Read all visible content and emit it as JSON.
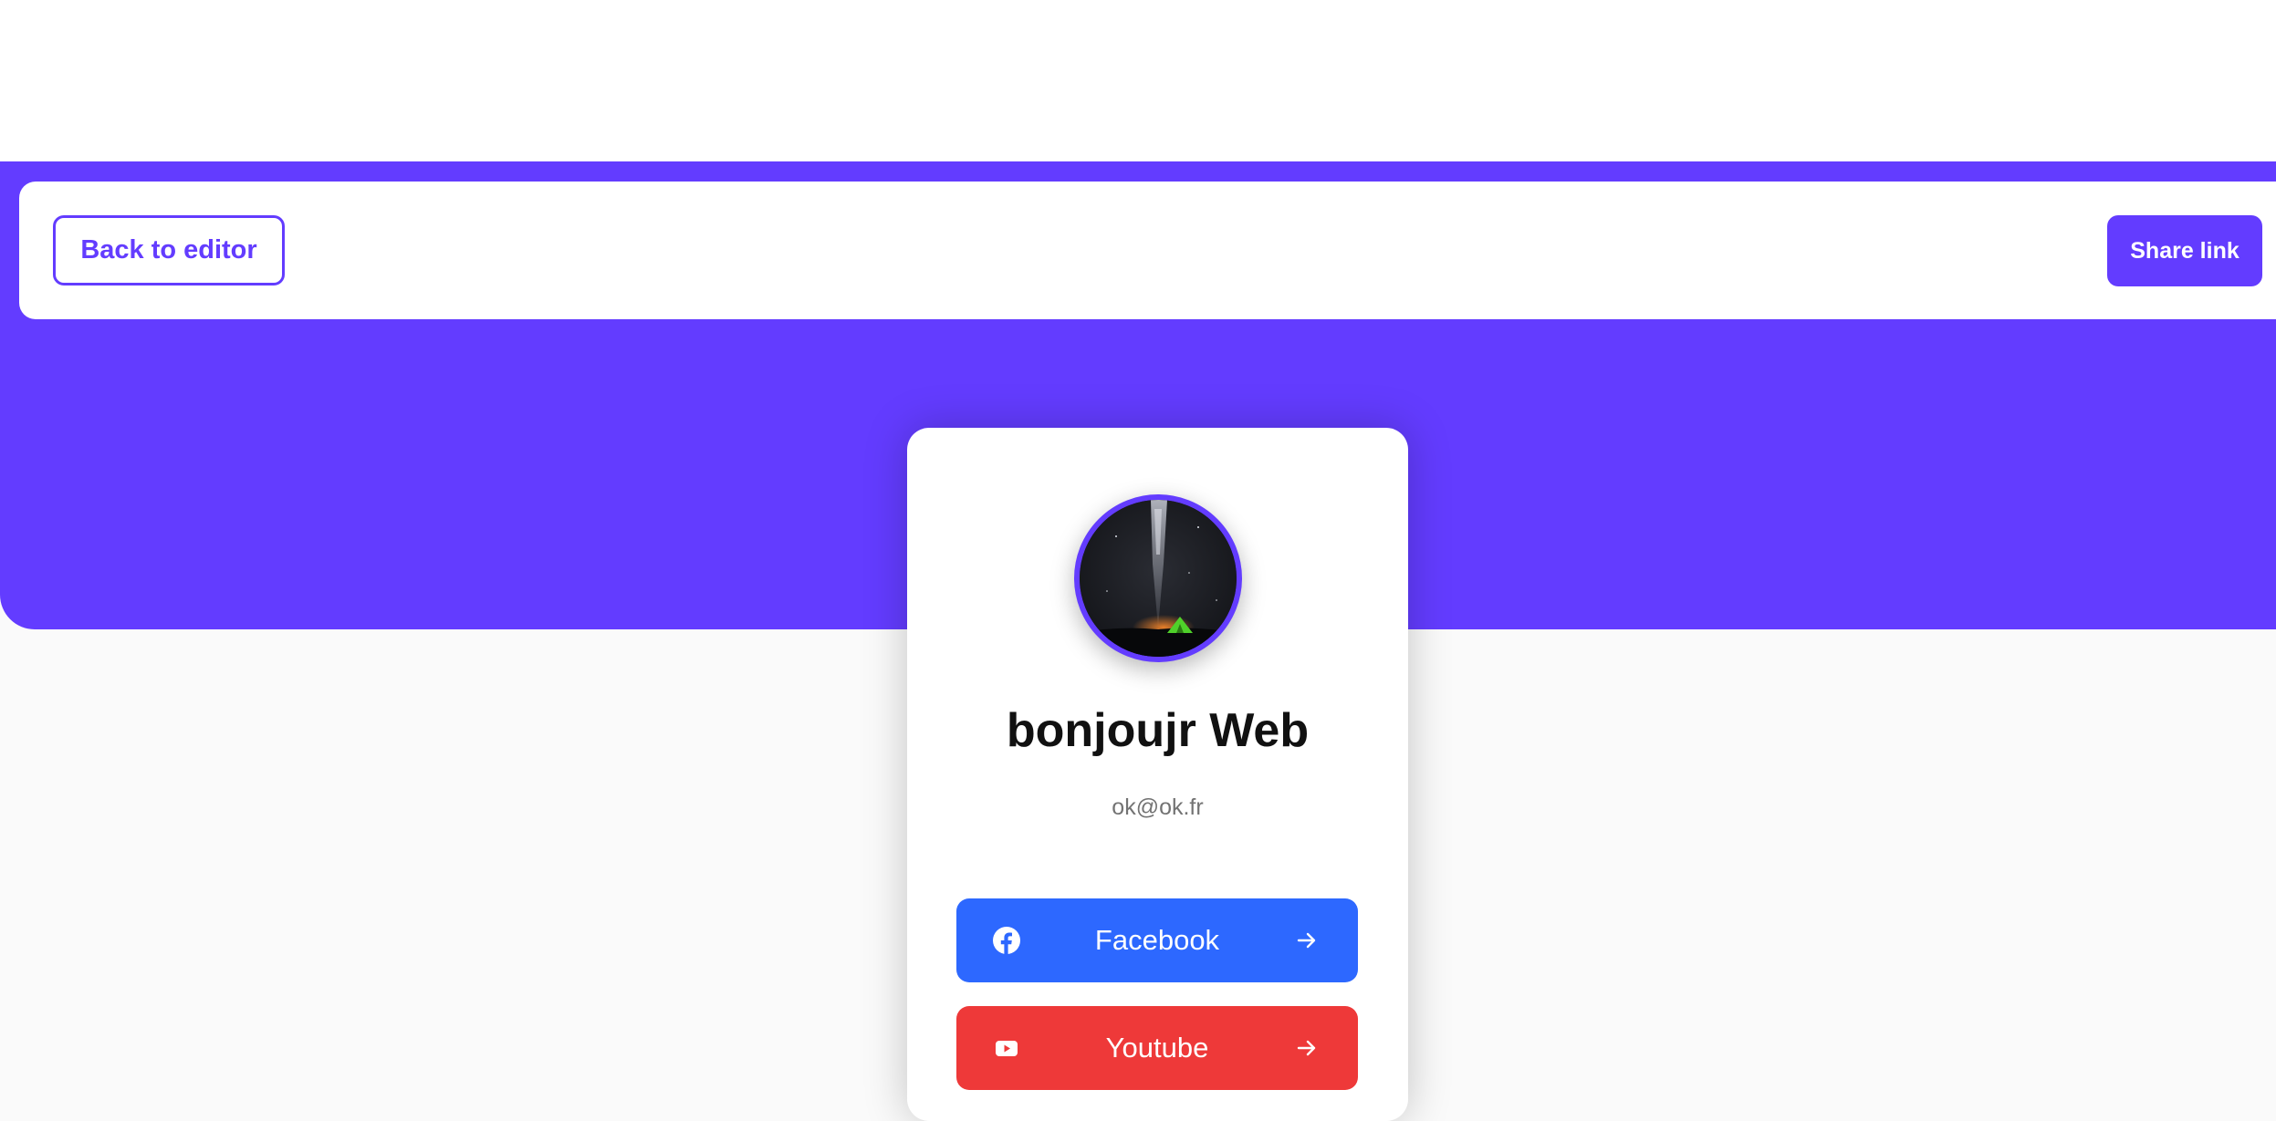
{
  "navbar": {
    "back_label": "Back to editor",
    "share_label": "Share link"
  },
  "profile": {
    "name": "bonjoujr Web",
    "email": "ok@ok.fr",
    "avatar_icon": "profile-photo-night-sky-tent"
  },
  "links": [
    {
      "platform": "Facebook",
      "icon": "facebook-icon",
      "color": "#2d68ff"
    },
    {
      "platform": "Youtube",
      "icon": "youtube-icon",
      "color": "#ee3939"
    }
  ],
  "colors": {
    "accent": "#633cff",
    "background": "#fafafa",
    "card": "#ffffff"
  }
}
